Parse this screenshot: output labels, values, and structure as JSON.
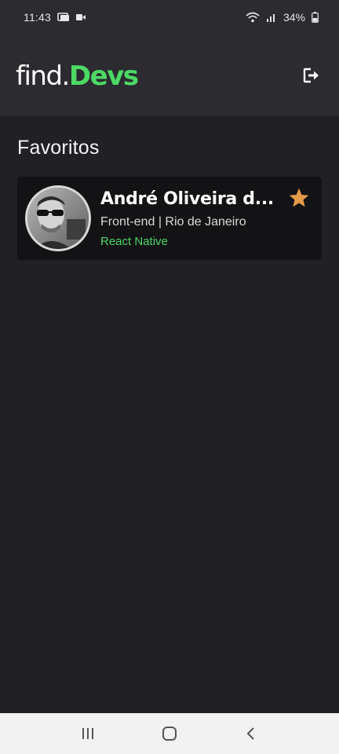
{
  "status_bar": {
    "time": "11:43",
    "battery": "34%",
    "icons": [
      "photo-icon",
      "video-icon",
      "wifi-icon",
      "signal-icon",
      "battery-icon"
    ]
  },
  "header": {
    "logo_prefix": "find.",
    "logo_accent": "Devs",
    "logout_icon": "logout-icon"
  },
  "colors": {
    "accent": "#4cd964",
    "star": "#e59a4a",
    "background": "#202025",
    "header": "#2b2b30",
    "card": "#131316"
  },
  "main": {
    "title": "Favoritos",
    "favorites": [
      {
        "name": "André Oliveira d...",
        "role": "Front-end | Rio de Janeiro",
        "tech": "React Native",
        "favorited": true
      }
    ]
  },
  "nav_bar": {
    "buttons": [
      "recent-apps-icon",
      "home-icon",
      "back-icon"
    ]
  }
}
